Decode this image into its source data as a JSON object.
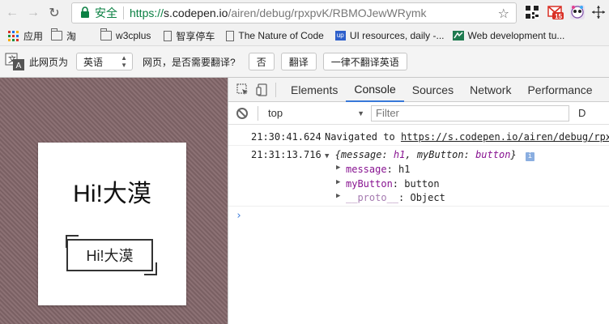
{
  "browser": {
    "security_label": "安全",
    "url_scheme": "https://",
    "url_host": "s.codepen.io",
    "url_path": "/airen/debug/rpxpvK/RBMOJewWRymk",
    "gmail_badge": "15"
  },
  "bookmarks": [
    {
      "label": "应用",
      "icon": "apps-grid-icon"
    },
    {
      "label": "淘",
      "icon": "folder-icon"
    },
    {
      "label": "w3cplus",
      "icon": "folder-icon"
    },
    {
      "label": "智享停车",
      "icon": "page-icon"
    },
    {
      "label": "The Nature of Code",
      "icon": "page-icon"
    },
    {
      "label": "UI resources, daily -...",
      "icon": "up-icon"
    },
    {
      "label": "Web development tu...",
      "icon": "codepen-icon"
    }
  ],
  "translate_bar": {
    "prefix": "此网页为",
    "language": "英语",
    "question": "网页，是否需要翻译?",
    "no_label": "否",
    "translate_label": "翻译",
    "never_label": "一律不翻译英语"
  },
  "page": {
    "heading": "Hi!大漠",
    "button_label": "Hi!大漠"
  },
  "devtools": {
    "tabs": [
      "Elements",
      "Console",
      "Sources",
      "Network",
      "Performance"
    ],
    "active_tab": "Console",
    "context": "top",
    "filter_placeholder": "Filter",
    "overflow_label": "D",
    "log": [
      {
        "time": "21:30:41.624",
        "text": "Navigated to",
        "link": "https://s.codepen.io/airen/debug/rpx"
      },
      {
        "time": "21:31:13.716",
        "summary_open": "{",
        "summary_k1": "message",
        "summary_v1": "h1",
        "summary_k2": "myButton",
        "summary_v2": "button",
        "summary_close": "}"
      }
    ],
    "object_props": [
      {
        "key": "message",
        "value": "h1"
      },
      {
        "key": "myButton",
        "value": "button"
      },
      {
        "key": "__proto__",
        "value": "Object"
      }
    ]
  },
  "colors": {
    "secure_green": "#0b8043",
    "devtools_accent": "#3879d9",
    "property_purple": "#881391"
  }
}
